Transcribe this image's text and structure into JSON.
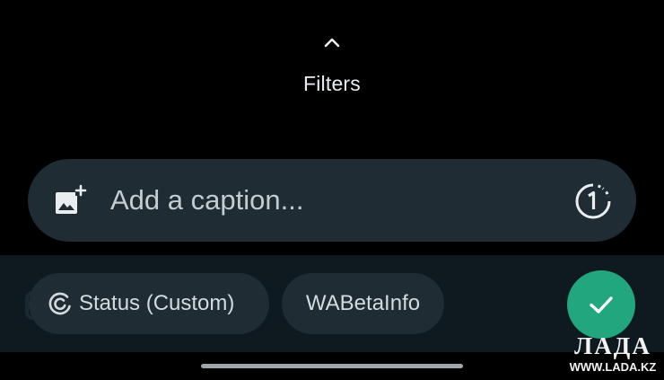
{
  "filters": {
    "label": "Filters",
    "icon": "chevron-up-icon"
  },
  "caption": {
    "placeholder": "Add a caption...",
    "value": "",
    "left_icon": "add-media-icon",
    "right_icon": "view-once-icon"
  },
  "recipients": {
    "status_chip": {
      "label": "Status (Custom)",
      "icon": "status-icon"
    },
    "contact_chip": {
      "label": "WABetaInfo"
    }
  },
  "send_button": {
    "icon": "checkmark-icon",
    "color": "#21a67d"
  },
  "colors": {
    "background": "#000000",
    "input_bar": "#1f2c34",
    "chip": "#1f2c34",
    "accent": "#21a67d"
  },
  "logo": {
    "title": "ЛАДА",
    "url": "WWW.LADA.KZ"
  }
}
